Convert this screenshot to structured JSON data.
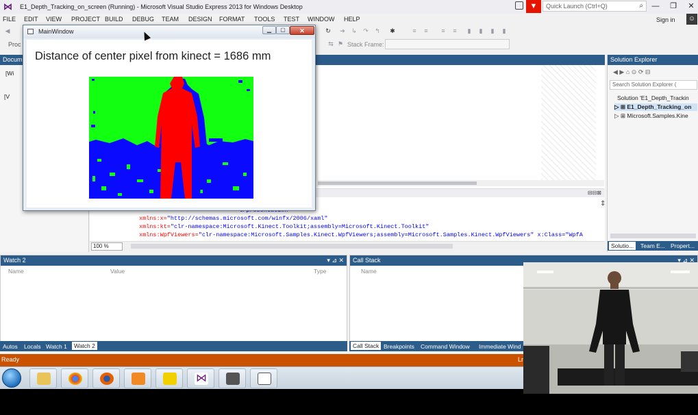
{
  "app": {
    "title": "E1_Depth_Tracking_on_screen (Running) - Microsoft Visual Studio Express 2013 for Windows Desktop",
    "quick_launch_placeholder": "Quick Launch (Ctrl+Q)",
    "sign_in": "Sign in"
  },
  "menu": [
    "FILE",
    "EDIT",
    "VIEW",
    "PROJECT",
    "BUILD",
    "DEBUG",
    "TEAM",
    "DESIGN",
    "FORMAT",
    "TOOLS",
    "TEST",
    "WINDOW",
    "HELP"
  ],
  "toolbar": {
    "proc_label": "Proc",
    "stack_frame_label": "Stack Frame:"
  },
  "doc_outline": {
    "header": "Docum",
    "item1": "[Wi",
    "item2": "[V"
  },
  "editor": {
    "xaml_lines": [
      {
        "attr": "",
        "val": "l/presentation\""
      },
      {
        "attr": "xmlns:x=",
        "val": "\"http://schemas.microsoft.com/winfx/2006/xaml\""
      },
      {
        "attr": "xmlns:kt=",
        "val": "\"clr-namespace:Microsoft.Kinect.Toolkit;assembly=Microsoft.Kinect.Toolkit\""
      },
      {
        "attr": "xmlns:WpfViewers=",
        "val": "\"clr-namespace:Microsoft.Samples.Kinect.WpfViewers;assembly=Microsoft.Samples.Kinect.WpfViewers\" x:Class=\"WpfA"
      }
    ],
    "zoom": "100 %"
  },
  "solution_explorer": {
    "header": "Solution Explorer",
    "search_placeholder": "Search Solution Explorer (",
    "items": [
      "Solution 'E1_Depth_Trackin",
      "E1_Depth_Tracking_on",
      "Microsoft.Samples.Kine"
    ],
    "tabs": [
      "Solutio...",
      "Team E...",
      "Propert..."
    ]
  },
  "watch": {
    "header": "Watch 2",
    "columns": [
      "Name",
      "Value",
      "Type"
    ],
    "tabs": [
      "Autos",
      "Locals",
      "Watch 1",
      "Watch 2"
    ],
    "active_tab": "Watch 2"
  },
  "callstack": {
    "header": "Call Stack",
    "columns": [
      "Name"
    ],
    "tabs": [
      "Call Stack",
      "Breakpoints",
      "Command Window",
      "Immediate Wind"
    ]
  },
  "status": {
    "left": "Ready",
    "right": "Ln"
  },
  "main_window": {
    "title": "MainWindow",
    "heading": "Distance of center pixel from kinect = 1686 mm"
  },
  "colors": {
    "vs_accent": "#68217a",
    "panel_header": "#2c5c8a",
    "status_bar": "#ca5100",
    "depth_near": "#ff0000",
    "depth_mid": "#12ff12",
    "depth_far": "#0a0aff"
  },
  "icons": {
    "close": "close-icon",
    "minimize": "minimize-icon",
    "maximize": "maximize-icon"
  }
}
